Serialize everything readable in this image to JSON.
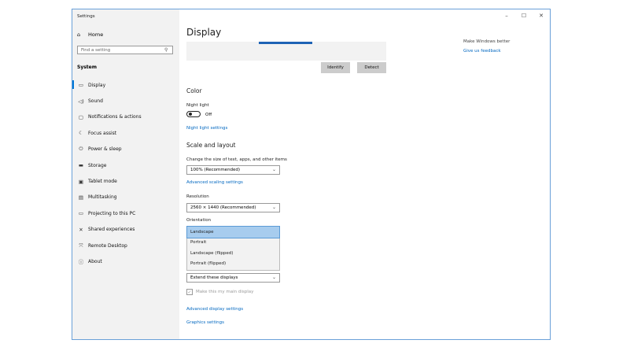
{
  "window": {
    "title": "Settings",
    "controls": {
      "minimize": "–",
      "maximize": "☐",
      "close": "✕"
    }
  },
  "sidebar": {
    "home": "Home",
    "search_placeholder": "Find a setting",
    "section": "System",
    "items": [
      {
        "label": "Display",
        "icon": "monitor-icon"
      },
      {
        "label": "Sound",
        "icon": "speaker-icon"
      },
      {
        "label": "Notifications & actions",
        "icon": "notification-icon"
      },
      {
        "label": "Focus assist",
        "icon": "moon-icon"
      },
      {
        "label": "Power & sleep",
        "icon": "power-icon"
      },
      {
        "label": "Storage",
        "icon": "storage-icon"
      },
      {
        "label": "Tablet mode",
        "icon": "tablet-icon"
      },
      {
        "label": "Multitasking",
        "icon": "multitasking-icon"
      },
      {
        "label": "Projecting to this PC",
        "icon": "projector-icon"
      },
      {
        "label": "Shared experiences",
        "icon": "shared-icon"
      },
      {
        "label": "Remote Desktop",
        "icon": "remote-icon"
      },
      {
        "label": "About",
        "icon": "info-icon"
      }
    ]
  },
  "main": {
    "title": "Display",
    "right_top_text": "Make Windows better",
    "feedback_link": "Give us feedback",
    "identify": "Identify",
    "detect": "Detect",
    "color_heading": "Color",
    "night_light_label": "Night light",
    "night_light_state": "Off",
    "night_light_settings": "Night light settings",
    "scale_heading": "Scale and layout",
    "scale_label": "Change the size of text, apps, and other items",
    "scale_value": "100% (Recommended)",
    "advanced_scaling": "Advanced scaling settings",
    "resolution_label": "Resolution",
    "resolution_value": "2560 × 1440 (Recommended)",
    "orientation_label": "Orientation",
    "orientation_options": [
      "Landscape",
      "Portrait",
      "Landscape (flipped)",
      "Portrait (flipped)"
    ],
    "multiple_displays_value": "Extend these displays",
    "main_display_label": "Make this my main display",
    "advanced_display": "Advanced display settings",
    "graphics_settings": "Graphics settings"
  }
}
